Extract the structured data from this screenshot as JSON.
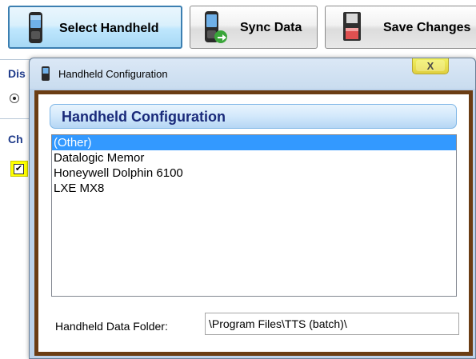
{
  "toolbar": {
    "select_handheld": "Select Handheld",
    "sync_data": "Sync Data",
    "save_changes": "Save Changes"
  },
  "background": {
    "fragment_top": "Dis",
    "fragment_mid": "Ch"
  },
  "dialog": {
    "title": "Handheld Configuration",
    "close_glyph": "X",
    "header": "Handheld Configuration",
    "devices": [
      "(Other)",
      "Datalogic Memor",
      "Honeywell Dolphin 6100",
      "LXE MX8"
    ],
    "selected_index": 0,
    "folder_label": "Handheld Data Folder:",
    "folder_value": "\\Program Files\\TTS (batch)\\"
  },
  "colors": {
    "frame_border": "#6b3d14",
    "selection": "#3399ff",
    "header_text": "#1a2a7a"
  },
  "icons": {
    "select_handheld": "handheld-device-icon",
    "sync_data": "handheld-sync-icon",
    "save_changes": "floppy-disk-icon",
    "title": "handheld-device-icon"
  }
}
